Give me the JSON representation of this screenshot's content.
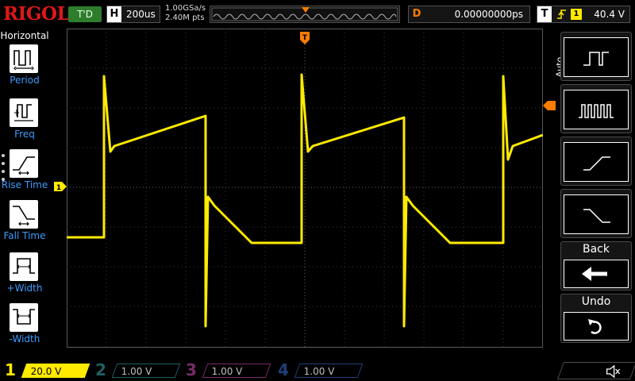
{
  "app": {
    "brand": "RIGOL"
  },
  "topbar": {
    "trigger_status": "T'D",
    "horizontal": {
      "letter": "H",
      "value": "200us"
    },
    "sample_rate": "1.00GSa/s",
    "memory_depth": "2.40M pts",
    "delay": {
      "letter": "D",
      "value": "0.00000000ps"
    },
    "trigger": {
      "letter": "T",
      "slope_icon": "rising-edge-icon",
      "source": "1",
      "level": "40.4 V"
    }
  },
  "left_menu": {
    "title": "Horizontal",
    "items": [
      {
        "label": "Period",
        "icon": "period-icon"
      },
      {
        "label": "Freq",
        "icon": "frequency-icon"
      },
      {
        "label": "Rise Time",
        "icon": "rise-time-icon"
      },
      {
        "label": "Fall Time",
        "icon": "fall-time-icon"
      },
      {
        "label": "+Width",
        "icon": "positive-width-icon"
      },
      {
        "label": "-Width",
        "icon": "negative-width-icon"
      }
    ]
  },
  "right_menu": {
    "mode": "Auto",
    "buttons": [
      {
        "icon": "single-pulse-waveform-icon"
      },
      {
        "icon": "pulse-train-waveform-icon"
      },
      {
        "icon": "rising-edge-waveform-icon"
      },
      {
        "icon": "falling-edge-waveform-icon"
      },
      {
        "label": "Back",
        "icon": "back-arrow-icon"
      },
      {
        "label": "Undo",
        "icon": "undo-icon"
      }
    ]
  },
  "markers": {
    "ch1_ground": "1",
    "trigger_position": "T"
  },
  "channels": [
    {
      "num": "1",
      "scale": "20.0 V",
      "color": "#ffea00"
    },
    {
      "num": "2",
      "scale": "1.00 V",
      "color": "#1f6060"
    },
    {
      "num": "3",
      "scale": "1.00 V",
      "color": "#7a2b6a"
    },
    {
      "num": "4",
      "scale": "1.00 V",
      "color": "#1f3f7a"
    }
  ],
  "colors": {
    "trace": "#ffea00",
    "grid": "#3a3a3a",
    "accent_orange": "#ff7d00",
    "label_blue": "#3d9cff",
    "status_green": "#2d7d2d"
  }
}
